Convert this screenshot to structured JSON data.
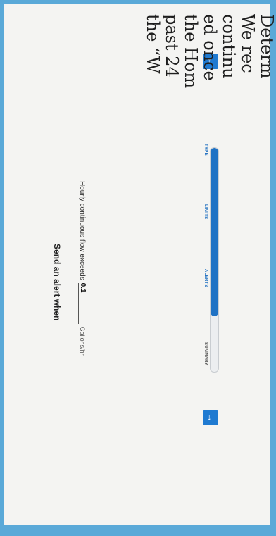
{
  "screen": {
    "title": "Send an alert when",
    "limit": {
      "label": "Hourly continuous flow exceeds",
      "value": "0.1",
      "unit": "Gallons/hr"
    },
    "steps": [
      {
        "label": "TYPE",
        "active": true
      },
      {
        "label": "LIMITS",
        "active": true
      },
      {
        "label": "ALERTS",
        "active": true
      },
      {
        "label": "SUMMARY",
        "active": false
      }
    ],
    "progress": 0.75,
    "back_icon": "arrow-left-icon",
    "next_icon": "arrow-right-icon"
  },
  "book": {
    "lines": [
      "Determ",
      "  We rec",
      "continu",
      "  ed once",
      "the Hom",
      "past 24 ",
      "   the “W"
    ]
  },
  "colors": {
    "accent": "#1f72c4",
    "border": "#5aa9d8"
  }
}
